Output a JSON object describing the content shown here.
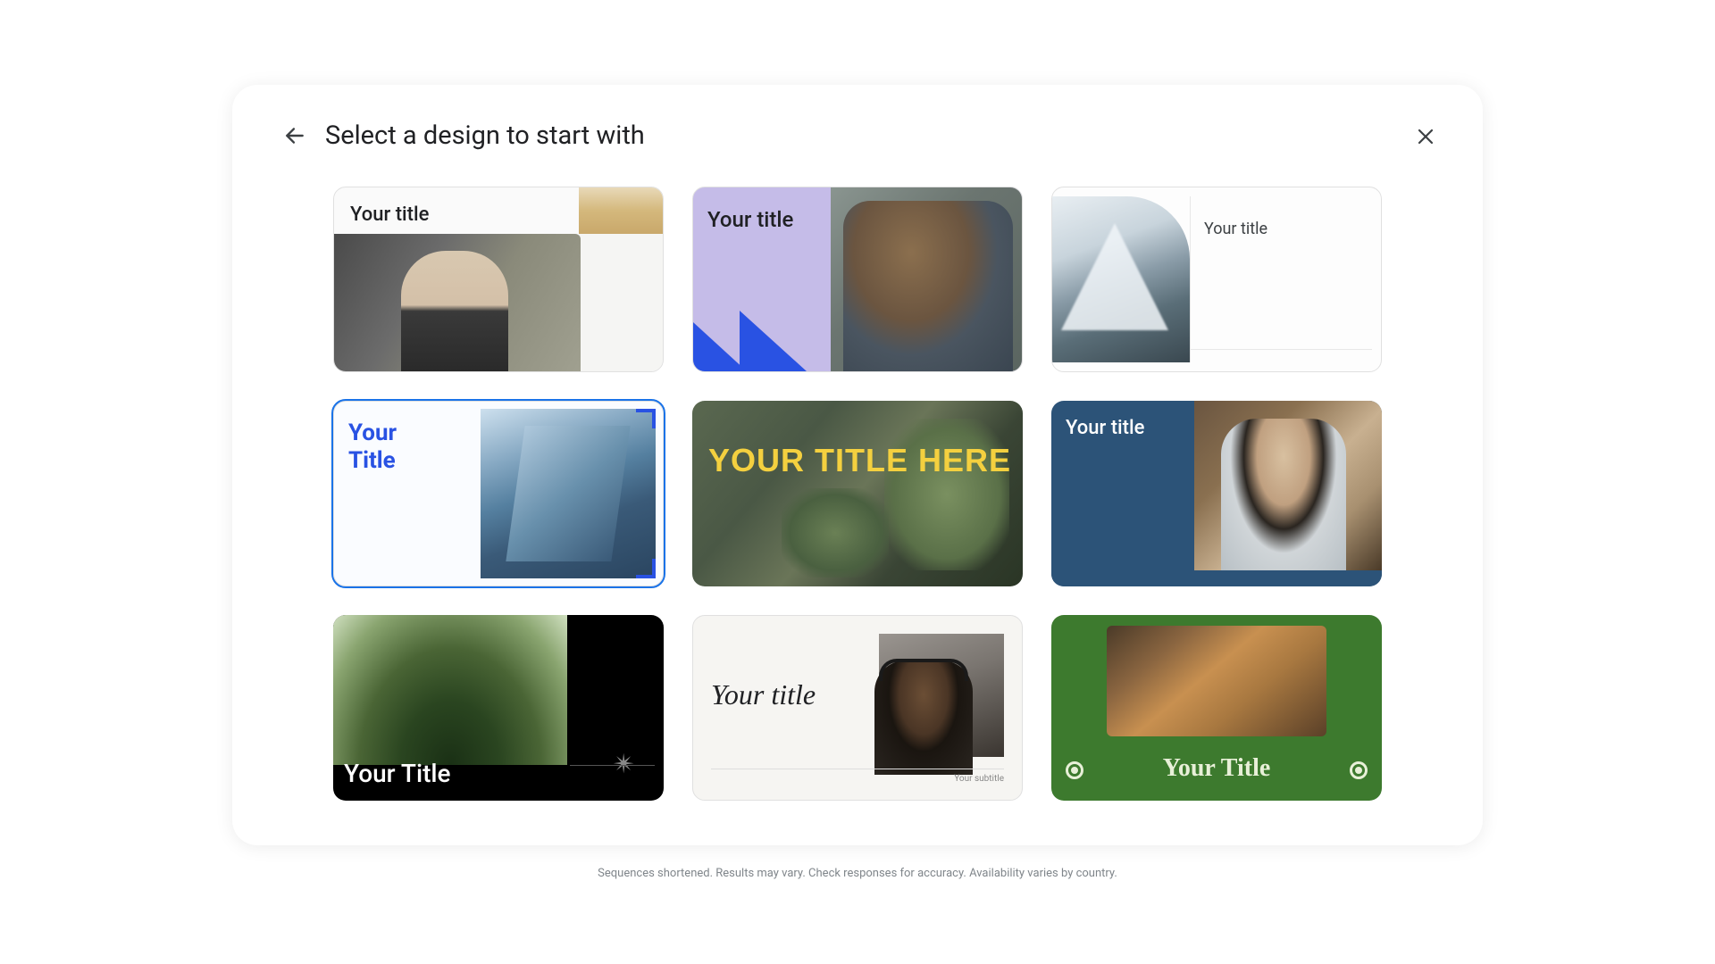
{
  "header": {
    "title": "Select a design to start with"
  },
  "templates": [
    {
      "title": "Your title"
    },
    {
      "title": "Your title"
    },
    {
      "title": "Your title"
    },
    {
      "title": "Your\nTitle"
    },
    {
      "title": "YOUR TITLE HERE"
    },
    {
      "title": "Your title"
    },
    {
      "title": "Your Title"
    },
    {
      "title": "Your title",
      "subtitle": "Your subtitle"
    },
    {
      "title": "Your Title"
    }
  ],
  "footer": {
    "disclaimer": "Sequences shortened. Results may vary. Check responses for accuracy. Availability varies by country."
  }
}
